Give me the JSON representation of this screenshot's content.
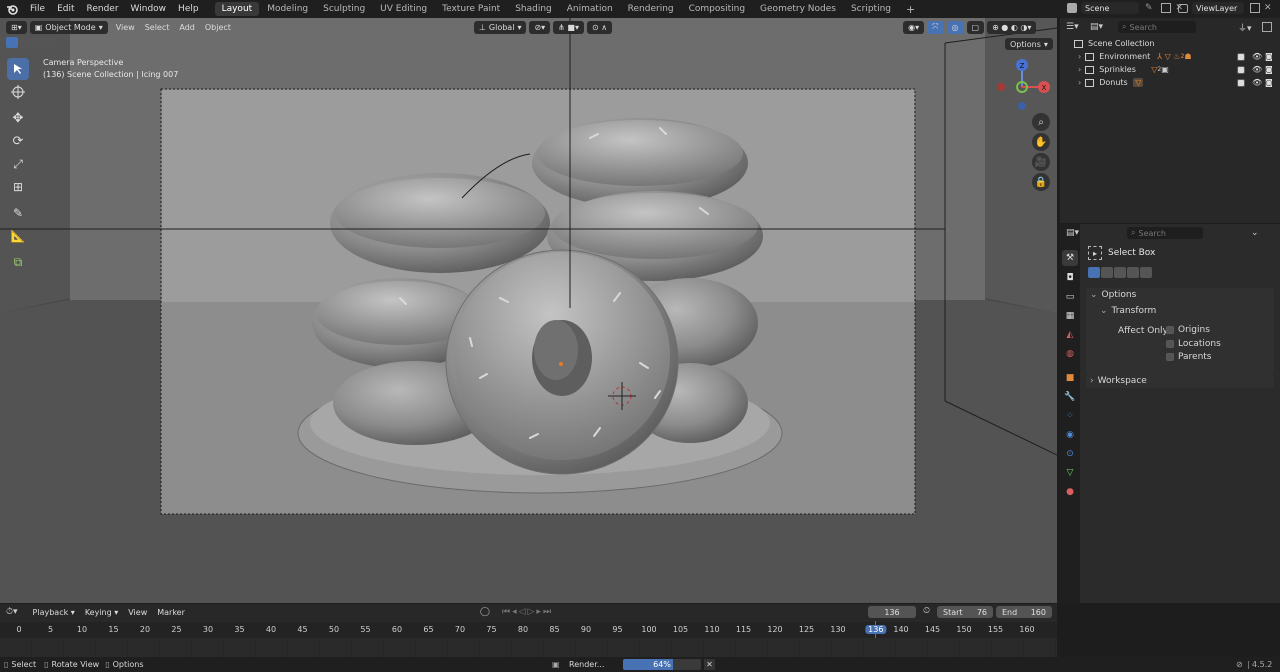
{
  "topbar": {
    "menus": [
      "File",
      "Edit",
      "Render",
      "Window",
      "Help"
    ],
    "workspaces": [
      {
        "label": "Layout",
        "active": true
      },
      {
        "label": "Modeling",
        "active": false
      },
      {
        "label": "Sculpting",
        "active": false
      },
      {
        "label": "UV Editing",
        "active": false
      },
      {
        "label": "Texture Paint",
        "active": false
      },
      {
        "label": "Shading",
        "active": false
      },
      {
        "label": "Animation",
        "active": false
      },
      {
        "label": "Rendering",
        "active": false
      },
      {
        "label": "Compositing",
        "active": false
      },
      {
        "label": "Geometry Nodes",
        "active": false
      },
      {
        "label": "Scripting",
        "active": false
      }
    ],
    "add_tab": "+",
    "scene": "Scene",
    "view_layer": "ViewLayer"
  },
  "viewport": {
    "mode": "Object Mode",
    "menus": [
      "View",
      "Select",
      "Add",
      "Object"
    ],
    "orientation": "Global",
    "options_label": "Options",
    "overlay_title": "Camera Perspective",
    "overlay_info": "(136) Scene Collection | Icing 007",
    "gizmo_axes": {
      "z": "Z",
      "x": "X"
    }
  },
  "outliner": {
    "search_placeholder": "Search",
    "root": "Scene Collection",
    "collections": [
      "Environment",
      "Sprinkles",
      "Donuts"
    ],
    "sprinkles_badge": "2",
    "environment_badge": "2"
  },
  "properties": {
    "search_placeholder": "Search",
    "tool_name": "Select Box",
    "options_label": "Options",
    "transform_label": "Transform",
    "affect_only_label": "Affect Only",
    "checkboxes": [
      "Origins",
      "Locations",
      "Parents"
    ],
    "workspace_label": "Workspace"
  },
  "timeline": {
    "menus": [
      "Playback",
      "Keying",
      "View",
      "Marker"
    ],
    "current_frame": "136",
    "start_label": "Start",
    "start": "76",
    "end_label": "End",
    "end": "160",
    "ticks": [
      "0",
      "5",
      "10",
      "15",
      "20",
      "25",
      "30",
      "35",
      "40",
      "45",
      "50",
      "55",
      "60",
      "65",
      "70",
      "75",
      "80",
      "85",
      "90",
      "95",
      "100",
      "105",
      "110",
      "115",
      "120",
      "125",
      "130",
      "136",
      "140",
      "145",
      "150",
      "155",
      "160"
    ]
  },
  "statusbar": {
    "select": "Select",
    "rotate": "Rotate View",
    "options": "Options",
    "render_label": "Render...",
    "render_progress": 0.64,
    "render_progress_text": "64%",
    "version": "4.5.2"
  },
  "colors": {
    "accent": "#4772b3",
    "active_tool": "#4d6fa8",
    "playhead": "#4772b3",
    "orange": "#e07b2a"
  }
}
